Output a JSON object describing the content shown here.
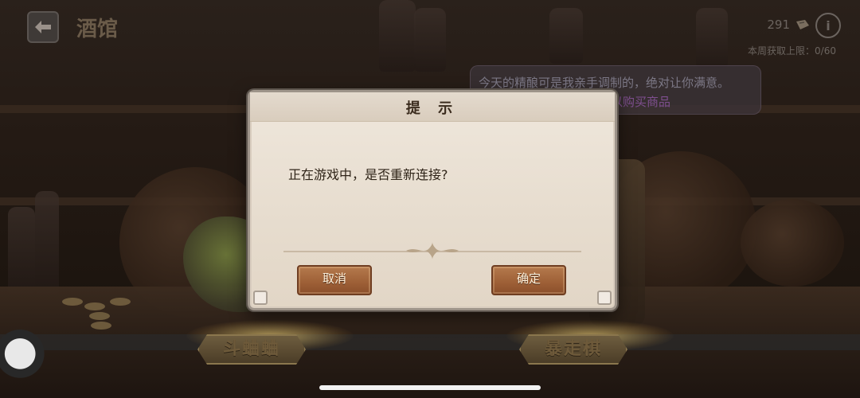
{
  "header": {
    "title": "酒馆",
    "currency_amount": "291",
    "weekly_limit_text": "本周获取上限：0/60"
  },
  "npc_bubble": {
    "line1": "今天的精酿可是我亲手调制的，绝对让你满意。",
    "line2": "以购买商品"
  },
  "modes": {
    "left_label": "斗蛐蛐",
    "right_label": "暴走棋"
  },
  "dialog": {
    "title": "提 示",
    "message": "正在游戏中，是否重新连接?",
    "cancel_label": "取消",
    "confirm_label": "确定"
  },
  "icons": {
    "back": "back-arrow-icon",
    "currency": "ticket-icon",
    "info": "info-icon"
  },
  "colors": {
    "dialog_bg": "#e7ddcf",
    "button_bg": "#9d5f36",
    "button_text": "#fff2dc"
  }
}
